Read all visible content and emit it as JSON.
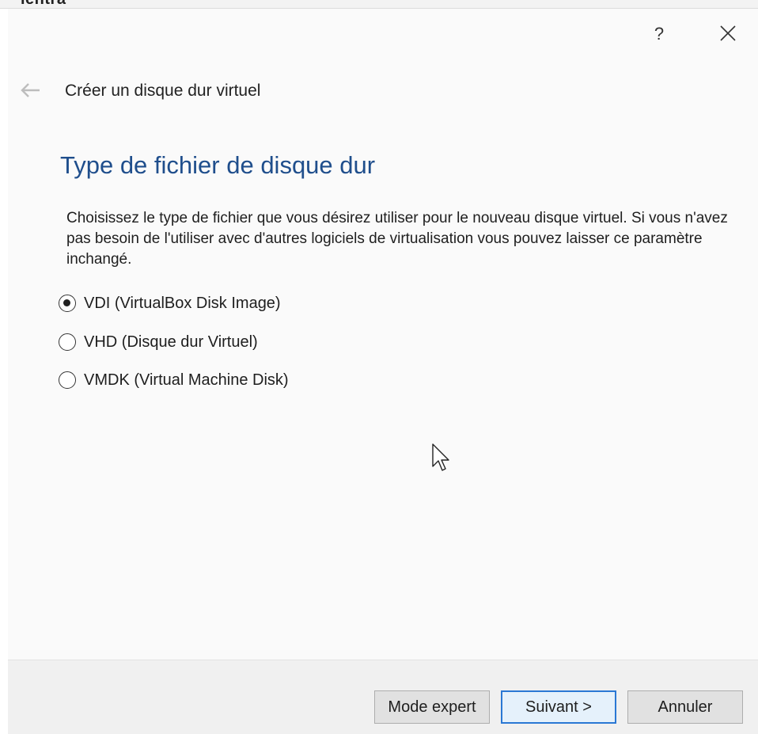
{
  "background": {
    "fragment": "ientra"
  },
  "titlebar": {
    "help_label": "?"
  },
  "wizard": {
    "title": "Créer un disque dur virtuel",
    "heading": "Type de fichier de disque dur",
    "description": "Choisissez le type de fichier que vous désirez utiliser pour le nouveau disque virtuel. Si vous n'avez pas besoin de l'utiliser avec d'autres logiciels de virtualisation vous pouvez laisser ce paramètre inchangé."
  },
  "options": [
    {
      "label": "VDI (VirtualBox Disk Image)",
      "selected": true
    },
    {
      "label": "VHD (Disque dur Virtuel)",
      "selected": false
    },
    {
      "label": "VMDK (Virtual Machine Disk)",
      "selected": false
    }
  ],
  "footer": {
    "expert_label": "Mode expert",
    "next_label": "Suivant >",
    "cancel_label": "Annuler"
  },
  "colors": {
    "heading": "#1f4e8c",
    "primary_border": "#2a78d4"
  }
}
